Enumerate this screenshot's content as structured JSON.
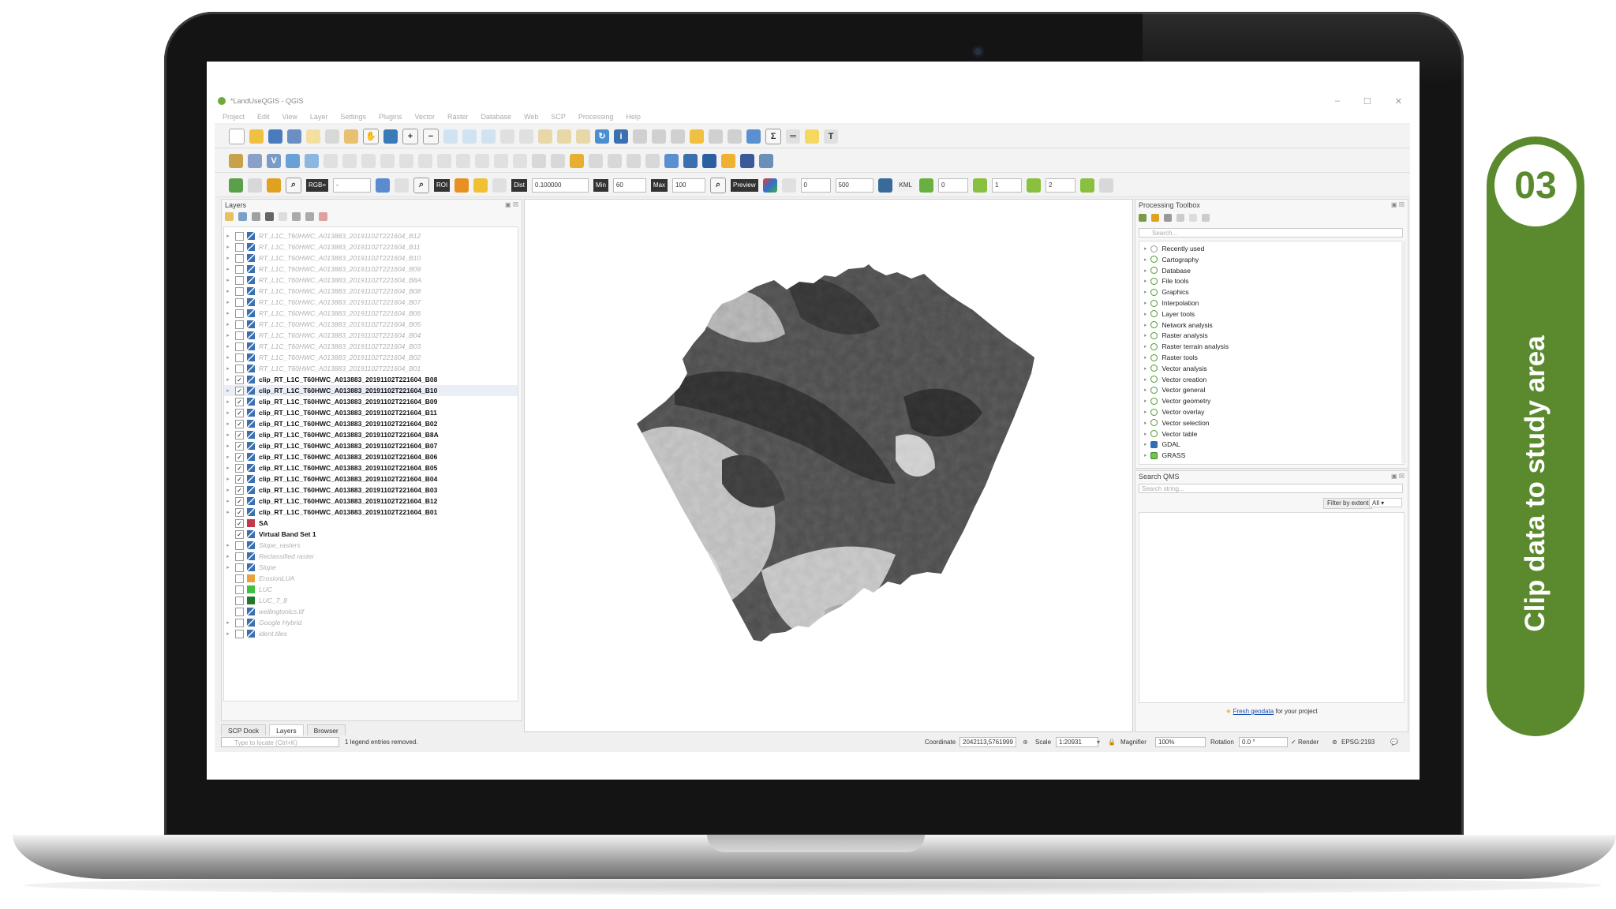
{
  "step": {
    "number": "03",
    "title": "Clip data to study area"
  },
  "colors": {
    "accent_green": "#5a8a2d",
    "qgis_green": "#6eaa35",
    "selection": "#e9eef7"
  },
  "window": {
    "title": "*LandUseQGIS - QGIS",
    "controls": [
      "–",
      "☐",
      "✕"
    ],
    "menu": [
      "Project",
      "Edit",
      "View",
      "Layer",
      "Settings",
      "Plugins",
      "Vector",
      "Raster",
      "Database",
      "Web",
      "SCP",
      "Processing",
      "Help"
    ]
  },
  "scp_toolbar": {
    "rgb_label": "RGB=",
    "rgb_value": "-",
    "roi_label": "ROI",
    "dist_label": "Dist",
    "dist_value": "0.100000",
    "min_label": "Min",
    "min_value": "60",
    "max_label": "Max",
    "max_value": "100",
    "preview_label": "Preview",
    "t_value": "0",
    "s_value": "500",
    "kml_label": "KML",
    "band_values": [
      "0",
      "1",
      "2"
    ]
  },
  "layers": {
    "title": "Layers",
    "items": [
      {
        "name": "RT_L1C_T60HWC_A013883_20191102T221604_B12",
        "style": "faint",
        "checked": false,
        "expand": true
      },
      {
        "name": "RT_L1C_T60HWC_A013883_20191102T221604_B11",
        "style": "faint",
        "checked": false,
        "expand": true
      },
      {
        "name": "RT_L1C_T60HWC_A013883_20191102T221604_B10",
        "style": "faint",
        "checked": false,
        "expand": true
      },
      {
        "name": "RT_L1C_T60HWC_A013883_20191102T221604_B09",
        "style": "faint",
        "checked": false,
        "expand": true
      },
      {
        "name": "RT_L1C_T60HWC_A013883_20191102T221604_B8A",
        "style": "faint",
        "checked": false,
        "expand": true
      },
      {
        "name": "RT_L1C_T60HWC_A013883_20191102T221604_B08",
        "style": "faint",
        "checked": false,
        "expand": true
      },
      {
        "name": "RT_L1C_T60HWC_A013883_20191102T221604_B07",
        "style": "faint",
        "checked": false,
        "expand": true
      },
      {
        "name": "RT_L1C_T60HWC_A013883_20191102T221604_B06",
        "style": "faint",
        "checked": false,
        "expand": true
      },
      {
        "name": "RT_L1C_T60HWC_A013883_20191102T221604_B05",
        "style": "faint",
        "checked": false,
        "expand": true
      },
      {
        "name": "RT_L1C_T60HWC_A013883_20191102T221604_B04",
        "style": "faint",
        "checked": false,
        "expand": true
      },
      {
        "name": "RT_L1C_T60HWC_A013883_20191102T221604_B03",
        "style": "faint",
        "checked": false,
        "expand": true
      },
      {
        "name": "RT_L1C_T60HWC_A013883_20191102T221604_B02",
        "style": "faint",
        "checked": false,
        "expand": true
      },
      {
        "name": "RT_L1C_T60HWC_A013883_20191102T221604_B01",
        "style": "faint",
        "checked": false,
        "expand": true
      },
      {
        "name": "clip_RT_L1C_T60HWC_A013883_20191102T221604_B08",
        "style": "bold",
        "checked": true,
        "expand": true
      },
      {
        "name": "clip_RT_L1C_T60HWC_A013883_20191102T221604_B10",
        "style": "bold",
        "checked": true,
        "expand": true,
        "selected": true
      },
      {
        "name": "clip_RT_L1C_T60HWC_A013883_20191102T221604_B09",
        "style": "bold",
        "checked": true,
        "expand": true
      },
      {
        "name": "clip_RT_L1C_T60HWC_A013883_20191102T221604_B11",
        "style": "bold",
        "checked": true,
        "expand": true
      },
      {
        "name": "clip_RT_L1C_T60HWC_A013883_20191102T221604_B02",
        "style": "bold",
        "checked": true,
        "expand": true
      },
      {
        "name": "clip_RT_L1C_T60HWC_A013883_20191102T221604_B8A",
        "style": "bold",
        "checked": true,
        "expand": true
      },
      {
        "name": "clip_RT_L1C_T60HWC_A013883_20191102T221604_B07",
        "style": "bold",
        "checked": true,
        "expand": true
      },
      {
        "name": "clip_RT_L1C_T60HWC_A013883_20191102T221604_B06",
        "style": "bold",
        "checked": true,
        "expand": true
      },
      {
        "name": "clip_RT_L1C_T60HWC_A013883_20191102T221604_B05",
        "style": "bold",
        "checked": true,
        "expand": true
      },
      {
        "name": "clip_RT_L1C_T60HWC_A013883_20191102T221604_B04",
        "style": "bold",
        "checked": true,
        "expand": true
      },
      {
        "name": "clip_RT_L1C_T60HWC_A013883_20191102T221604_B03",
        "style": "bold",
        "checked": true,
        "expand": true
      },
      {
        "name": "clip_RT_L1C_T60HWC_A013883_20191102T221604_B12",
        "style": "bold",
        "checked": true,
        "expand": true
      },
      {
        "name": "clip_RT_L1C_T60HWC_A013883_20191102T221604_B01",
        "style": "bold",
        "checked": true,
        "expand": true
      },
      {
        "name": "SA",
        "style": "bold",
        "checked": true,
        "expand": false,
        "swatch": "#c0394a"
      },
      {
        "name": "Virtual Band Set 1",
        "style": "bold",
        "checked": true,
        "expand": false
      },
      {
        "name": "Slope_rasters",
        "style": "faint",
        "checked": false,
        "expand": true
      },
      {
        "name": "Reclassified raster",
        "style": "faint",
        "checked": false,
        "expand": true
      },
      {
        "name": "Slope",
        "style": "faint",
        "checked": false,
        "expand": true
      },
      {
        "name": "ErosionLUA",
        "style": "faint",
        "checked": false,
        "expand": false,
        "swatch": "#e7a23a"
      },
      {
        "name": "LUC",
        "style": "faint",
        "checked": false,
        "expand": false,
        "swatch": "#43c043"
      },
      {
        "name": "LUC_7_8",
        "style": "faint",
        "checked": false,
        "expand": false,
        "swatch": "#1e7a2a"
      },
      {
        "name": "wellingtonlcs.tif",
        "style": "faint",
        "checked": false,
        "expand": false
      },
      {
        "name": "Google Hybrid",
        "style": "faint",
        "checked": false,
        "expand": true
      },
      {
        "name": "ident.tiles",
        "style": "faint",
        "checked": false,
        "expand": true
      }
    ],
    "tabs": [
      "SCP Dock",
      "Layers",
      "Browser"
    ],
    "active_tab": "Layers"
  },
  "processing": {
    "title": "Processing Toolbox",
    "search_placeholder": "Search...",
    "items": [
      {
        "label": "Recently used",
        "icon": "recent"
      },
      {
        "label": "Cartography",
        "icon": "q"
      },
      {
        "label": "Database",
        "icon": "q"
      },
      {
        "label": "File tools",
        "icon": "q"
      },
      {
        "label": "Graphics",
        "icon": "q"
      },
      {
        "label": "Interpolation",
        "icon": "q"
      },
      {
        "label": "Layer tools",
        "icon": "q"
      },
      {
        "label": "Network analysis",
        "icon": "q"
      },
      {
        "label": "Raster analysis",
        "icon": "q"
      },
      {
        "label": "Raster terrain analysis",
        "icon": "q"
      },
      {
        "label": "Raster tools",
        "icon": "q"
      },
      {
        "label": "Vector analysis",
        "icon": "q"
      },
      {
        "label": "Vector creation",
        "icon": "q"
      },
      {
        "label": "Vector general",
        "icon": "q"
      },
      {
        "label": "Vector geometry",
        "icon": "q"
      },
      {
        "label": "Vector overlay",
        "icon": "q"
      },
      {
        "label": "Vector selection",
        "icon": "q"
      },
      {
        "label": "Vector table",
        "icon": "q"
      },
      {
        "label": "GDAL",
        "icon": "gdal"
      },
      {
        "label": "GRASS",
        "icon": "grass"
      }
    ]
  },
  "qms": {
    "title": "Search QMS",
    "search_placeholder": "Search string...",
    "filter_button": "Filter by extent",
    "filter_value": "All",
    "footer_link": "Fresh geodata",
    "footer_text": " for your project"
  },
  "status": {
    "locator_placeholder": "Type to locate (Ctrl+K)",
    "message": "1 legend entries removed.",
    "coordinate_label": "Coordinate",
    "coordinate_value": "2042113,5761999",
    "scale_label": "Scale",
    "scale_value": "1:20931",
    "magnifier_label": "Magnifier",
    "magnifier_value": "100%",
    "rotation_label": "Rotation",
    "rotation_value": "0.0 °",
    "render_label": "Render",
    "crs": "EPSG:2193"
  }
}
